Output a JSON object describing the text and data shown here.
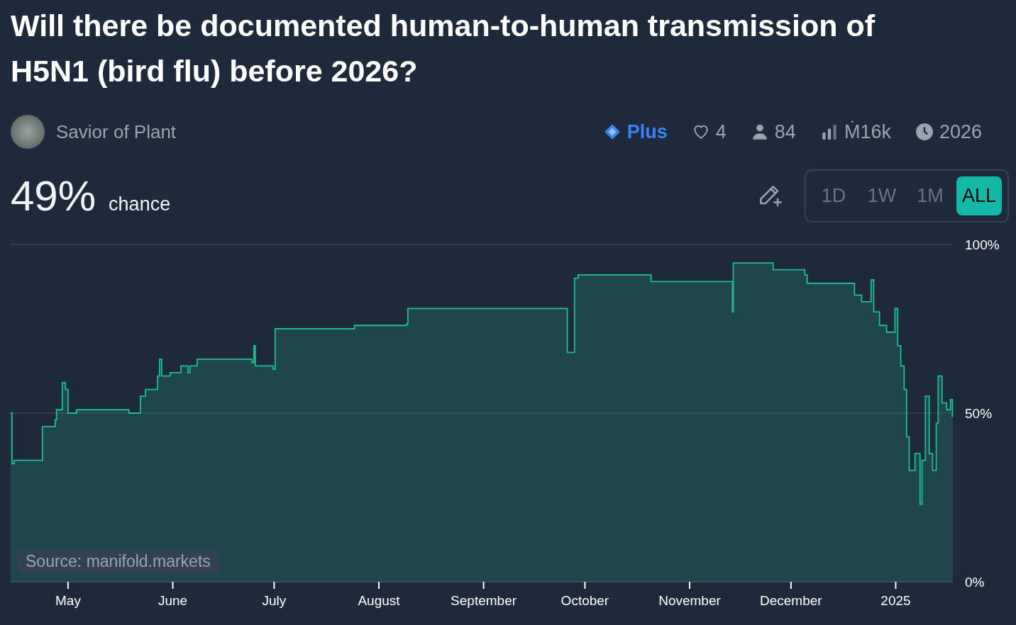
{
  "title": "Will there be documented human-to-human transmission of H5N1 (bird flu) before 2026?",
  "creator": {
    "name": "Savior of Plant"
  },
  "stats": [
    {
      "kind": "plus",
      "text": "Plus"
    },
    {
      "kind": "likes",
      "text": "4"
    },
    {
      "kind": "traders",
      "text": "84"
    },
    {
      "kind": "volume",
      "text": "Ṁ16k"
    },
    {
      "kind": "close",
      "text": "2026"
    }
  ],
  "probability": {
    "value": "49%",
    "label": "chance"
  },
  "ranges": [
    {
      "label": "1D",
      "selected": false
    },
    {
      "label": "1W",
      "selected": false
    },
    {
      "label": "1M",
      "selected": false
    },
    {
      "label": "ALL",
      "selected": true
    }
  ],
  "source": "Source: manifold.markets",
  "chart_data": {
    "type": "area",
    "xlim": [
      "2024-04-14T00:00",
      "2025-01-17T22:00"
    ],
    "ylim": [
      0,
      100
    ],
    "xticks": [
      {
        "value": "2024-05-01T00:00",
        "label": "May"
      },
      {
        "value": "2024-06-01T00:00",
        "label": "June"
      },
      {
        "value": "2024-07-01T00:00",
        "label": "July"
      },
      {
        "value": "2024-08-01T00:00",
        "label": "August"
      },
      {
        "value": "2024-09-01T00:00",
        "label": "September"
      },
      {
        "value": "2024-10-01T00:00",
        "label": "October"
      },
      {
        "value": "2024-11-01T00:00",
        "label": "November"
      },
      {
        "value": "2024-12-01T00:00",
        "label": "December"
      },
      {
        "value": "2025-01-01T00:00",
        "label": "2025"
      }
    ],
    "yticks": [
      {
        "value": 0,
        "label": "0%"
      },
      {
        "value": 50,
        "label": "50%"
      },
      {
        "value": 100,
        "label": "100%"
      }
    ],
    "x": [
      "2024-04-14T00:00",
      "2024-04-14T10:00",
      "2024-04-14T10:00",
      "2024-04-15T00:00",
      "2024-04-15T00:00",
      "2024-04-23T10:00",
      "2024-04-23T10:00",
      "2024-04-27T05:00",
      "2024-04-27T05:00",
      "2024-04-27T14:00",
      "2024-04-27T14:00",
      "2024-04-29T07:00",
      "2024-04-29T07:00",
      "2024-04-30T05:00",
      "2024-04-30T05:00",
      "2024-05-01T00:00",
      "2024-05-01T00:00",
      "2024-05-03T12:00",
      "2024-05-03T12:00",
      "2024-05-19T00:00",
      "2024-05-19T00:00",
      "2024-05-22T10:00",
      "2024-05-22T10:00",
      "2024-05-23T22:00",
      "2024-05-23T22:00",
      "2024-05-27T12:00",
      "2024-05-27T12:00",
      "2024-05-28T02:00",
      "2024-05-28T02:00",
      "2024-05-28T17:00",
      "2024-05-28T17:00",
      "2024-05-31T05:00",
      "2024-05-31T05:00",
      "2024-06-03T10:00",
      "2024-06-03T10:00",
      "2024-06-05T12:00",
      "2024-06-05T12:00",
      "2024-06-06T02:00",
      "2024-06-06T02:00",
      "2024-06-08T05:00",
      "2024-06-08T05:00",
      "2024-06-24T10:00",
      "2024-06-24T10:00",
      "2024-06-25T00:00",
      "2024-06-25T00:00",
      "2024-06-25T10:00",
      "2024-06-25T10:00",
      "2024-06-30T17:00",
      "2024-06-30T17:00",
      "2024-07-01T07:00",
      "2024-07-01T07:00",
      "2024-07-24T19:00",
      "2024-07-24T19:00",
      "2024-08-09T05:00",
      "2024-08-09T05:00",
      "2024-08-09T14:00",
      "2024-08-09T14:00",
      "2024-09-25T19:00",
      "2024-09-25T19:00",
      "2024-09-27T22:00",
      "2024-09-27T22:00",
      "2024-09-29T00:00",
      "2024-09-29T00:00",
      "2024-10-20T14:00",
      "2024-10-20T14:00",
      "2024-11-13T17:00",
      "2024-11-13T17:00",
      "2024-11-13T22:00",
      "2024-11-13T22:00",
      "2024-11-25T17:00",
      "2024-11-25T17:00",
      "2024-12-05T02:00",
      "2024-12-05T02:00",
      "2024-12-05T19:00",
      "2024-12-05T19:00",
      "2024-12-19T19:00",
      "2024-12-19T19:00",
      "2024-12-21T22:00",
      "2024-12-21T22:00",
      "2024-12-24T17:00",
      "2024-12-24T17:00",
      "2024-12-25T12:00",
      "2024-12-25T12:00",
      "2024-12-27T05:00",
      "2024-12-27T05:00",
      "2024-12-29T07:00",
      "2024-12-29T07:00",
      "2024-12-31T19:00",
      "2024-12-31T19:00",
      "2025-01-01T14:00",
      "2025-01-01T14:00",
      "2025-01-02T12:00",
      "2025-01-02T12:00",
      "2025-01-03T12:00",
      "2025-01-03T12:00",
      "2025-01-04T05:00",
      "2025-01-04T05:00",
      "2025-01-05T00:00",
      "2025-01-05T00:00",
      "2025-01-06T17:00",
      "2025-01-06T17:00",
      "2025-01-08T05:00",
      "2025-01-08T05:00",
      "2025-01-08T19:00",
      "2025-01-08T19:00",
      "2025-01-09T19:00",
      "2025-01-09T19:00",
      "2025-01-10T22:00",
      "2025-01-10T22:00",
      "2025-01-11T22:00",
      "2025-01-11T22:00",
      "2025-01-13T00:00",
      "2025-01-13T00:00",
      "2025-01-13T14:00",
      "2025-01-13T14:00",
      "2025-01-14T17:00",
      "2025-01-14T17:00",
      "2025-01-16T02:00",
      "2025-01-16T02:00",
      "2025-01-17T05:00",
      "2025-01-17T05:00",
      "2025-01-17T19:00",
      "2025-01-17T19:00",
      "2025-01-17T22:00"
    ],
    "series": [
      {
        "color": "#1fbf8f",
        "values": [
          50,
          50,
          35,
          35,
          36,
          36,
          46,
          46,
          48,
          48,
          51,
          51,
          59,
          59,
          57,
          57,
          50,
          50,
          51,
          51,
          50,
          50,
          55,
          55,
          57,
          57,
          61,
          61,
          66,
          66,
          61,
          61,
          62,
          62,
          64,
          64,
          62,
          62,
          64,
          64,
          66,
          66,
          65,
          65,
          70,
          70,
          64,
          64,
          63,
          63,
          75,
          75,
          76,
          76,
          76.5,
          76.5,
          81,
          81,
          68,
          68,
          90,
          90,
          91,
          91,
          89,
          89,
          80,
          80,
          94.5,
          94.5,
          92.5,
          92.5,
          91,
          91,
          88.5,
          88.5,
          85,
          85,
          83,
          83,
          89.5,
          89.5,
          80,
          80,
          76,
          76,
          74,
          74,
          81,
          81,
          70,
          70,
          64,
          64,
          57,
          57,
          43,
          43,
          33,
          33,
          38,
          38,
          23,
          23,
          36,
          36,
          55,
          55,
          38,
          38,
          33,
          33,
          47,
          47,
          61,
          61,
          53,
          53,
          51,
          51,
          54,
          54,
          49,
          49
        ]
      }
    ]
  }
}
